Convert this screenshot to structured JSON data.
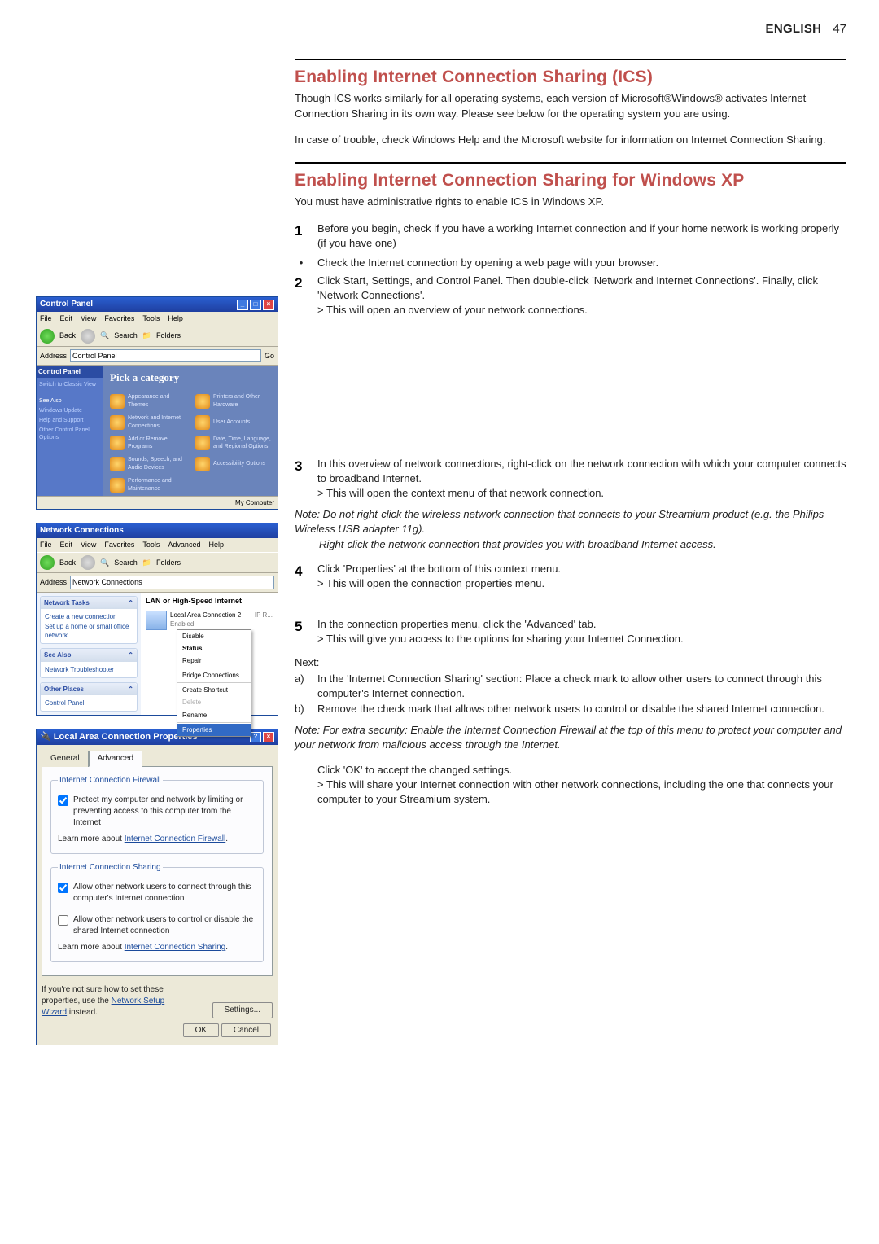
{
  "header": {
    "lang": "ENGLISH",
    "page": "47"
  },
  "sec1": {
    "title": "Enabling Internet Connection Sharing (ICS)",
    "p1": "Though ICS works similarly for all operating systems, each version of Microsoft®Windows® activates Internet Connection Sharing in its own way. Please see below for the operating system you are using.",
    "p2": "In case of trouble, check Windows Help and the Microsoft website for information on Internet Connection Sharing."
  },
  "sec2": {
    "title": "Enabling Internet Connection Sharing for Windows XP",
    "p1": "You must have administrative rights to enable ICS in Windows XP.",
    "s1": "Before you begin, check if you have a working Internet connection and if your home network is working properly (if you have one)",
    "b1": "Check the Internet connection by opening a web page with your browser.",
    "s2": "Click Start, Settings, and Control Panel. Then double-click 'Network and Internet Connections'. Finally, click 'Network Connections'.",
    "s2r": "> This will open an overview of your network connections.",
    "s3": "In this overview of network connections, right-click on the network connection with which your computer connects to broadband Internet.",
    "s3r": "> This will open the context menu of that network connection.",
    "note1a": "Note: Do not right-click the wireless network connection that connects to your Streamium product (e.g. the Philips Wireless USB adapter 11g).",
    "note1b": "Right-click the network connection that provides you with broadband Internet access.",
    "s4": "Click 'Properties' at the bottom of this context menu.",
    "s4r": "> This will open the connection properties menu.",
    "s5": "In the connection properties menu, click the 'Advanced' tab.",
    "s5r": "> This will give you access to the options for sharing your Internet Connection.",
    "next": "Next:",
    "a": "In the 'Internet Connection Sharing' section: Place a check mark to allow other users to connect through this computer's Internet connection.",
    "b": "Remove the check mark that allows other network users to control or disable the shared Internet connection.",
    "note2": "Note: For extra security: Enable the Internet Connection Firewall at the top of this menu to protect your computer and your network from malicious access through the Internet.",
    "ok": "Click 'OK' to accept the changed settings.",
    "okr": "> This will share your Internet connection with other network connections, including the one that connects your computer to your Streamium system."
  },
  "cp": {
    "title": "Control Panel",
    "menu": [
      "File",
      "Edit",
      "View",
      "Favorites",
      "Tools",
      "Help"
    ],
    "back": "Back",
    "search": "Search",
    "folders": "Folders",
    "addr_lbl": "Address",
    "addr": "Control Panel",
    "go": "Go",
    "side_head": "Control Panel",
    "side1": "Switch to Classic View",
    "seealso": "See Also",
    "sa1": "Windows Update",
    "sa2": "Help and Support",
    "sa3": "Other Control Panel Options",
    "pick": "Pick a category",
    "cats": [
      "Appearance and Themes",
      "Printers and Other Hardware",
      "Network and Internet Connections",
      "User Accounts",
      "Add or Remove Programs",
      "Date, Time, Language, and Regional Options",
      "Sounds, Speech, and Audio Devices",
      "Accessibility Options",
      "Performance and Maintenance"
    ],
    "status": "My Computer"
  },
  "nc": {
    "title": "Network Connections",
    "menu": [
      "File",
      "Edit",
      "View",
      "Favorites",
      "Tools",
      "Advanced",
      "Help"
    ],
    "back": "Back",
    "search": "Search",
    "folders": "Folders",
    "addr_lbl": "Address",
    "addr": "Network Connections",
    "p1": "Network Tasks",
    "p1a": "Create a new connection",
    "p1b": "Set up a home or small office network",
    "p2": "See Also",
    "p2a": "Network Troubleshooter",
    "p3": "Other Places",
    "p3a": "Control Panel",
    "grp": "LAN or High-Speed Internet",
    "conn_name": "Local Area Connection 2",
    "conn_state": "Enabled",
    "conn_dev": "IP R...",
    "ctx": [
      "Disable",
      "Status",
      "Repair",
      "",
      "Bridge Connections",
      "",
      "Create Shortcut",
      "Delete",
      "Rename",
      "",
      "Properties"
    ]
  },
  "dlg": {
    "title": "Local Area Connection Properties",
    "tab1": "General",
    "tab2": "Advanced",
    "fw": "Internet Connection Firewall",
    "fw_chk": "Protect my computer and network by limiting or preventing access to this computer from the Internet",
    "fw_more_pre": "Learn more about ",
    "fw_more_link": "Internet Connection Firewall",
    "fw_more_post": ".",
    "ics": "Internet Connection Sharing",
    "ics_chk1": "Allow other network users to connect through this computer's Internet connection",
    "ics_chk2": "Allow other network users to control or disable the shared Internet connection",
    "ics_more_pre": "Learn more about ",
    "ics_more_link": "Internet Connection Sharing",
    "ics_more_post": ".",
    "hint_pre": "If you're not sure how to set these properties, use the ",
    "hint_link": "Network Setup Wizard",
    "hint_post": " instead.",
    "settings": "Settings...",
    "ok": "OK",
    "cancel": "Cancel"
  }
}
